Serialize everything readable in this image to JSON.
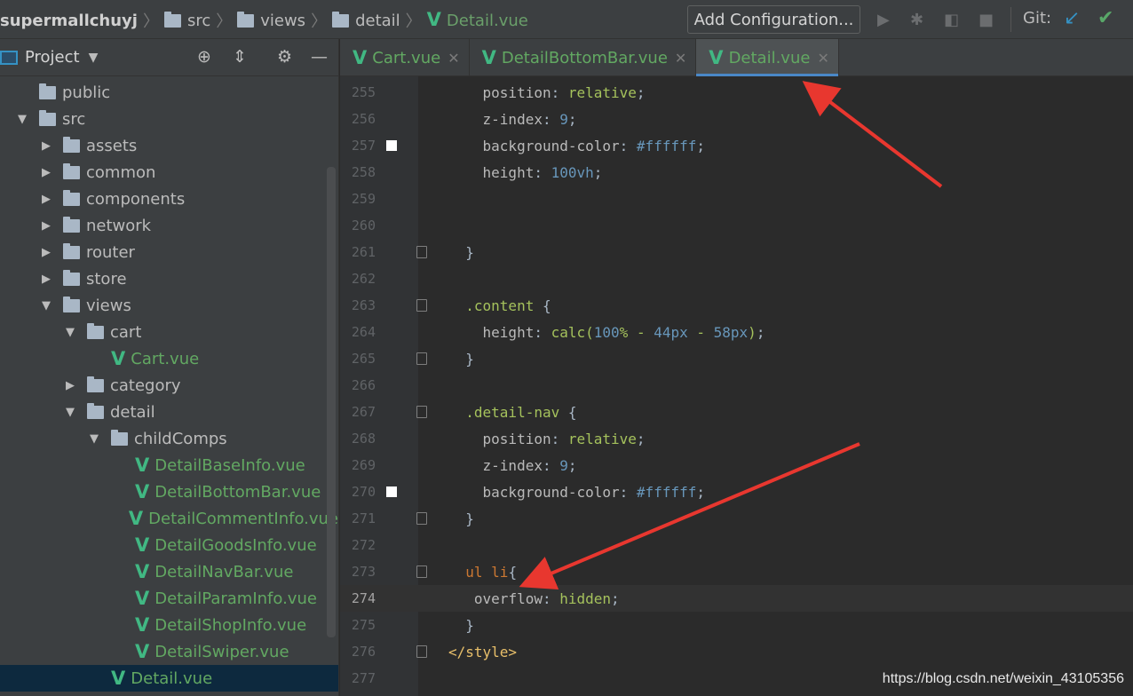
{
  "breadcrumb": {
    "project": "supermallchuyj",
    "items": [
      "src",
      "views",
      "detail"
    ],
    "file": "Detail.vue"
  },
  "toolbar": {
    "add_configuration": "Add Configuration...",
    "git_label": "Git:",
    "icons": [
      "run-icon",
      "debug-icon",
      "coverage-icon",
      "stop-icon",
      "git-update-icon",
      "git-commit-icon"
    ]
  },
  "sidebar": {
    "title": "Project",
    "tree": [
      {
        "label": "public",
        "type": "folder",
        "indent": 0,
        "arrow": ""
      },
      {
        "label": "src",
        "type": "folder",
        "indent": 0,
        "arrow": "▼"
      },
      {
        "label": "assets",
        "type": "folder",
        "indent": 1,
        "arrow": "▶"
      },
      {
        "label": "common",
        "type": "folder",
        "indent": 1,
        "arrow": "▶"
      },
      {
        "label": "components",
        "type": "folder",
        "indent": 1,
        "arrow": "▶"
      },
      {
        "label": "network",
        "type": "folder",
        "indent": 1,
        "arrow": "▶"
      },
      {
        "label": "router",
        "type": "folder",
        "indent": 1,
        "arrow": "▶"
      },
      {
        "label": "store",
        "type": "folder",
        "indent": 1,
        "arrow": "▶"
      },
      {
        "label": "views",
        "type": "folder",
        "indent": 1,
        "arrow": "▼"
      },
      {
        "label": "cart",
        "type": "folder",
        "indent": 2,
        "arrow": "▼"
      },
      {
        "label": "Cart.vue",
        "type": "vue",
        "indent": 3,
        "arrow": ""
      },
      {
        "label": "category",
        "type": "folder",
        "indent": 2,
        "arrow": "▶"
      },
      {
        "label": "detail",
        "type": "folder",
        "indent": 2,
        "arrow": "▼"
      },
      {
        "label": "childComps",
        "type": "folder",
        "indent": 3,
        "arrow": "▼"
      },
      {
        "label": "DetailBaseInfo.vue",
        "type": "vue",
        "indent": 4,
        "arrow": ""
      },
      {
        "label": "DetailBottomBar.vue",
        "type": "vue",
        "indent": 4,
        "arrow": ""
      },
      {
        "label": "DetailCommentInfo.vue",
        "type": "vue",
        "indent": 4,
        "arrow": ""
      },
      {
        "label": "DetailGoodsInfo.vue",
        "type": "vue",
        "indent": 4,
        "arrow": ""
      },
      {
        "label": "DetailNavBar.vue",
        "type": "vue",
        "indent": 4,
        "arrow": ""
      },
      {
        "label": "DetailParamInfo.vue",
        "type": "vue",
        "indent": 4,
        "arrow": ""
      },
      {
        "label": "DetailShopInfo.vue",
        "type": "vue",
        "indent": 4,
        "arrow": ""
      },
      {
        "label": "DetailSwiper.vue",
        "type": "vue",
        "indent": 4,
        "arrow": ""
      },
      {
        "label": "Detail.vue",
        "type": "vue",
        "indent": 3,
        "arrow": "",
        "selected": true
      }
    ]
  },
  "tabs": [
    {
      "label": "Cart.vue",
      "active": false
    },
    {
      "label": "DetailBottomBar.vue",
      "active": false
    },
    {
      "label": "Detail.vue",
      "active": true
    }
  ],
  "editor": {
    "current_line": 274,
    "lines": [
      {
        "n": "255",
        "code": [
          [
            "    ",
            ""
          ],
          [
            "position",
            ": c-prop"
          ],
          [
            ": ",
            ""
          ],
          [
            "relative",
            "c-val"
          ],
          [
            ";",
            ""
          ]
        ]
      },
      {
        "n": "256",
        "code": [
          [
            "    ",
            ""
          ],
          [
            "z-index",
            "c-prop"
          ],
          [
            ": ",
            ""
          ],
          [
            "9",
            "c-num"
          ],
          [
            ";",
            ""
          ]
        ]
      },
      {
        "n": "257",
        "code": [
          [
            "    ",
            ""
          ],
          [
            "background-color",
            "c-prop"
          ],
          [
            ": ",
            ""
          ],
          [
            "#ffffff",
            "c-num"
          ],
          [
            ";",
            ""
          ]
        ],
        "marker": true
      },
      {
        "n": "258",
        "code": [
          [
            "    ",
            ""
          ],
          [
            "height",
            "c-prop"
          ],
          [
            ": ",
            ""
          ],
          [
            "100vh",
            "c-num"
          ],
          [
            ";",
            ""
          ]
        ]
      },
      {
        "n": "259",
        "code": []
      },
      {
        "n": "260",
        "code": []
      },
      {
        "n": "261",
        "code": [
          [
            "  }",
            ""
          ]
        ],
        "fold": true
      },
      {
        "n": "262",
        "code": []
      },
      {
        "n": "263",
        "code": [
          [
            "  ",
            ""
          ],
          [
            ".content",
            "c-cls"
          ],
          [
            " {",
            ""
          ]
        ],
        "fold": true
      },
      {
        "n": "264",
        "code": [
          [
            "    ",
            ""
          ],
          [
            "height",
            "c-prop"
          ],
          [
            ": ",
            ""
          ],
          [
            "calc(",
            "c-val"
          ],
          [
            "100",
            "c-num"
          ],
          [
            "% - ",
            "c-val"
          ],
          [
            "44px",
            "c-num"
          ],
          [
            " - ",
            "c-val"
          ],
          [
            "58px",
            "c-num"
          ],
          [
            ")",
            "c-val"
          ],
          [
            ";",
            ""
          ]
        ]
      },
      {
        "n": "265",
        "code": [
          [
            "  }",
            ""
          ]
        ],
        "fold": true
      },
      {
        "n": "266",
        "code": []
      },
      {
        "n": "267",
        "code": [
          [
            "  ",
            ""
          ],
          [
            ".detail-nav",
            "c-cls"
          ],
          [
            " {",
            ""
          ]
        ],
        "fold": true
      },
      {
        "n": "268",
        "code": [
          [
            "    ",
            ""
          ],
          [
            "position",
            "c-prop"
          ],
          [
            ": ",
            ""
          ],
          [
            "relative",
            "c-val"
          ],
          [
            ";",
            ""
          ]
        ]
      },
      {
        "n": "269",
        "code": [
          [
            "    ",
            ""
          ],
          [
            "z-index",
            "c-prop"
          ],
          [
            ": ",
            ""
          ],
          [
            "9",
            "c-num"
          ],
          [
            ";",
            ""
          ]
        ]
      },
      {
        "n": "270",
        "code": [
          [
            "    ",
            ""
          ],
          [
            "background-color",
            "c-prop"
          ],
          [
            ": ",
            ""
          ],
          [
            "#ffffff",
            "c-num"
          ],
          [
            ";",
            ""
          ]
        ],
        "marker": true
      },
      {
        "n": "271",
        "code": [
          [
            "  }",
            ""
          ]
        ],
        "fold": true
      },
      {
        "n": "272",
        "code": []
      },
      {
        "n": "273",
        "code": [
          [
            "  ",
            ""
          ],
          [
            "ul li",
            "c-kw"
          ],
          [
            "{",
            ""
          ]
        ],
        "fold": true
      },
      {
        "n": "274",
        "code": [
          [
            "   ",
            ""
          ],
          [
            "overflow",
            "c-prop"
          ],
          [
            ": ",
            ""
          ],
          [
            "hidden",
            "c-val"
          ],
          [
            ";",
            ""
          ]
        ]
      },
      {
        "n": "275",
        "code": [
          [
            "  }",
            ""
          ]
        ]
      },
      {
        "n": "276",
        "code": [
          [
            "",
            ""
          ],
          [
            "</style>",
            "c-tag"
          ]
        ],
        "fold": true
      },
      {
        "n": "277",
        "code": []
      }
    ]
  },
  "watermark": "https://blog.csdn.net/weixin_43105356",
  "colors": {
    "vue_green": "#41b883",
    "arrow_red": "#e8372f",
    "tab_underline": "#4a88c7"
  }
}
